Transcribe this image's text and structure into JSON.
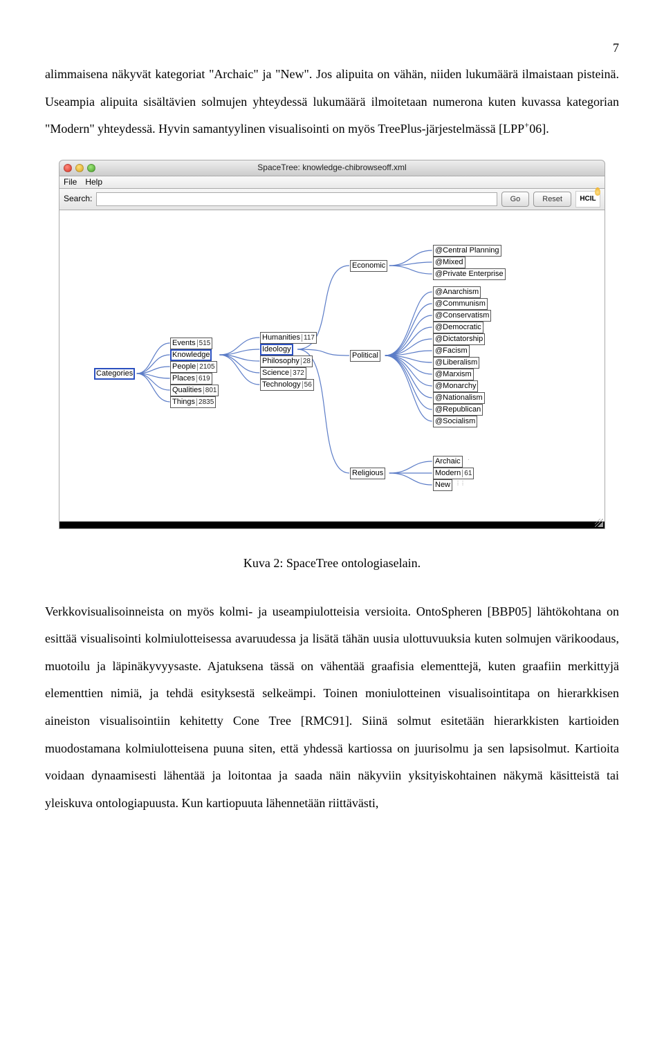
{
  "page_number": "7",
  "para1": "alimmaisena näkyvät kategoriat \"Archaic\" ja \"New\". Jos alipuita on vähän, niiden lukumäärä ilmaistaan pisteinä. Useampia alipuita sisältävien solmujen yhteydessä lukumäärä ilmoitetaan numerona kuten kuvassa kategorian \"Modern\" yhteydessä. Hyvin samantyylinen visualisointi on myös TreePlus-järjestelmässä [LPP+06].",
  "figure_caption": "Kuva 2: SpaceTree ontologiaselain.",
  "para2": "Verkkovisualisoinneista on myös kolmi- ja useampiulotteisia versioita. OntoSpheren [BBP05] lähtökohtana on esittää visualisointi kolmiulotteisessa avaruudessa ja lisätä tähän uusia ulottuvuuksia kuten solmujen värikoodaus, muotoilu ja läpinäkyvyysaste. Ajatuksena tässä on vähentää graafisia elementtejä, kuten graafiin merkittyjä elementtien nimiä, ja tehdä esityksestä selkeämpi. Toinen moniulotteinen visualisointitapa on hierarkkisen aineiston visualisointiin kehitetty Cone Tree [RMC91]. Siinä solmut esitetään hierarkkisten kartioiden muodostamana kolmiulotteisena puuna siten, että yhdessä kartiossa on juurisolmu ja sen lapsisolmut. Kartioita voidaan dynaamisesti lähentää ja loitontaa ja saada näin näkyviin yksityiskohtainen näkymä käsitteistä tai yleiskuva ontologiapuusta. Kun kartiopuuta lähennetään riittävästi,",
  "screenshot": {
    "window_title": "SpaceTree: knowledge-chibrowseoff.xml",
    "menu": {
      "file": "File",
      "help": "Help"
    },
    "search": {
      "label": "Search:",
      "placeholder": "",
      "go": "Go",
      "reset": "Reset"
    },
    "logo_text": "HCIL",
    "root": "Categories",
    "level1": [
      {
        "label": "Events",
        "count": "515"
      },
      {
        "label": "Knowledge",
        "selected": true
      },
      {
        "label": "People",
        "count": "2105"
      },
      {
        "label": "Places",
        "count": "619"
      },
      {
        "label": "Qualities",
        "count": "801"
      },
      {
        "label": "Things",
        "count": "2835"
      }
    ],
    "level2": [
      {
        "label": "Humanities",
        "count": "117"
      },
      {
        "label": "Ideology",
        "selected": true
      },
      {
        "label": "Philosophy",
        "count": "28"
      },
      {
        "label": "Science",
        "count": "372"
      },
      {
        "label": "Technology",
        "count": "56"
      }
    ],
    "level3": [
      {
        "label": "Economic"
      },
      {
        "label": "Political"
      },
      {
        "label": "Religious"
      }
    ],
    "economic_children": [
      {
        "label": "@Central Planning"
      },
      {
        "label": "@Mixed"
      },
      {
        "label": "@Private Enterprise"
      }
    ],
    "political_children": [
      {
        "label": "@Anarchism"
      },
      {
        "label": "@Communism"
      },
      {
        "label": "@Conservatism"
      },
      {
        "label": "@Democratic"
      },
      {
        "label": "@Dictatorship"
      },
      {
        "label": "@Facism"
      },
      {
        "label": "@Liberalism"
      },
      {
        "label": "@Marxism"
      },
      {
        "label": "@Monarchy"
      },
      {
        "label": "@Nationalism"
      },
      {
        "label": "@Republican"
      },
      {
        "label": "@Socialism"
      }
    ],
    "religious_children": [
      {
        "label": "Archaic"
      },
      {
        "label": "Modern",
        "count": "61"
      },
      {
        "label": "New"
      }
    ]
  }
}
